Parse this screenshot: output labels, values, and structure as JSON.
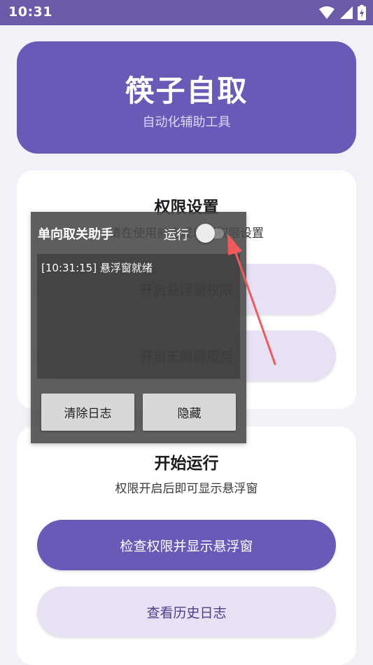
{
  "status_bar": {
    "time": "10:31",
    "icons": [
      "wifi-icon",
      "signal-icon",
      "battery-charging-icon"
    ],
    "color": "#6b5aa8"
  },
  "header": {
    "title": "筷子自取",
    "subtitle": "自动化辅助工具",
    "color": "#6a59b7"
  },
  "permissions_card": {
    "title": "权限设置",
    "description": "请在使用前完成以下权限设置",
    "buttons": [
      {
        "label": "开启悬浮窗权限"
      },
      {
        "label": "开启无障碍服务"
      }
    ]
  },
  "run_card": {
    "title": "开始运行",
    "description": "权限开启后即可显示悬浮窗",
    "buttons": [
      {
        "label": "检查权限并显示悬浮窗"
      },
      {
        "label": "查看历史日志"
      }
    ]
  },
  "overlay": {
    "title": "单向取关助手",
    "run_label": "运行",
    "run_enabled": false,
    "log": [
      "[10:31:15] 悬浮窗就绪"
    ],
    "clear_button": "清除日志",
    "hide_button": "隐藏"
  },
  "annotation": {
    "icon": "red-arrow-icon",
    "color": "#f05a5a"
  }
}
